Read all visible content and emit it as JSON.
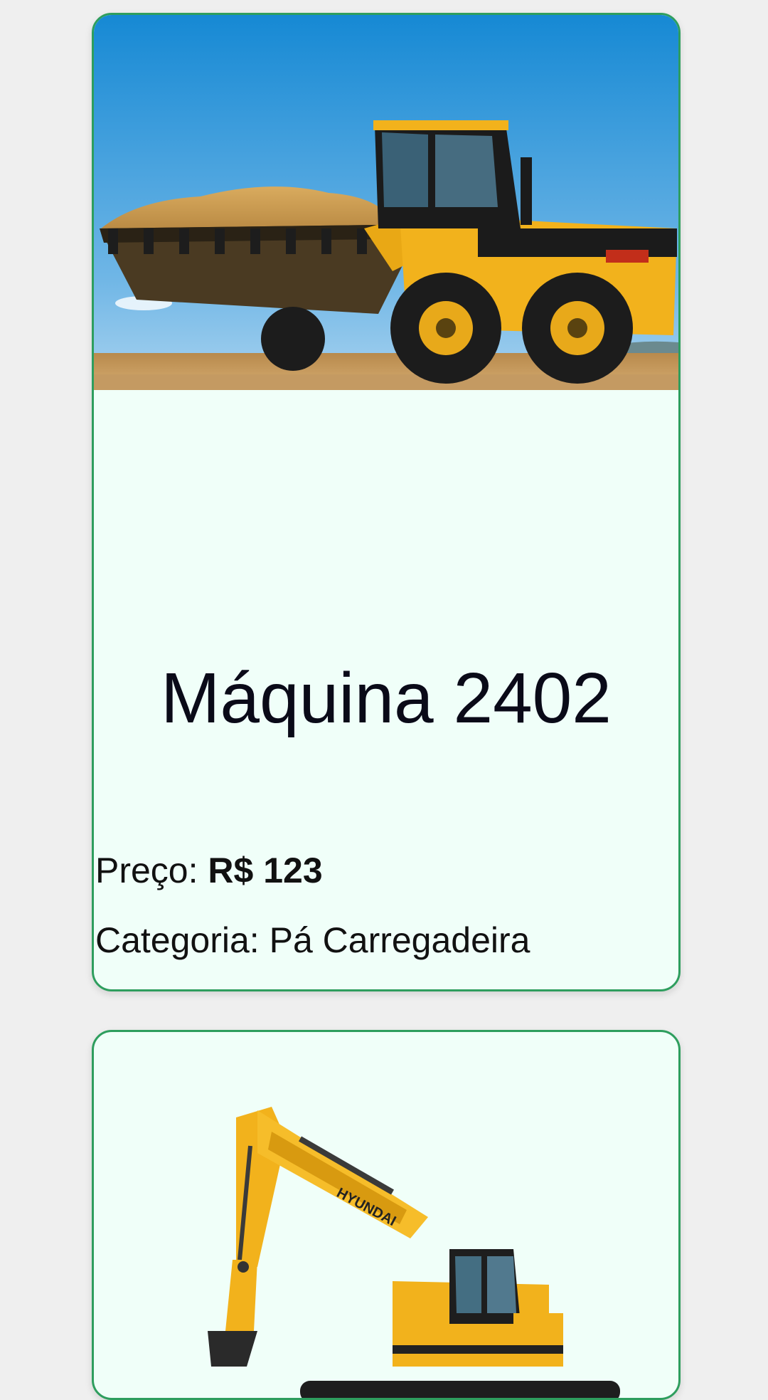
{
  "listings": [
    {
      "title": "Máquina 2402",
      "price_label": "Preço:",
      "price_value": "R$ 123",
      "category_label": "Categoria:",
      "category_value": "Pá Carregadeira",
      "image_icon": "wheel-loader-photo"
    },
    {
      "image_icon": "hyundai-excavator-photo",
      "brand_text": "HYUNDAI"
    }
  ],
  "colors": {
    "page_bg": "#efefef",
    "card_bg": "#f0fff9",
    "card_border": "#2e9e5e",
    "machine_yellow": "#f2b21c"
  }
}
